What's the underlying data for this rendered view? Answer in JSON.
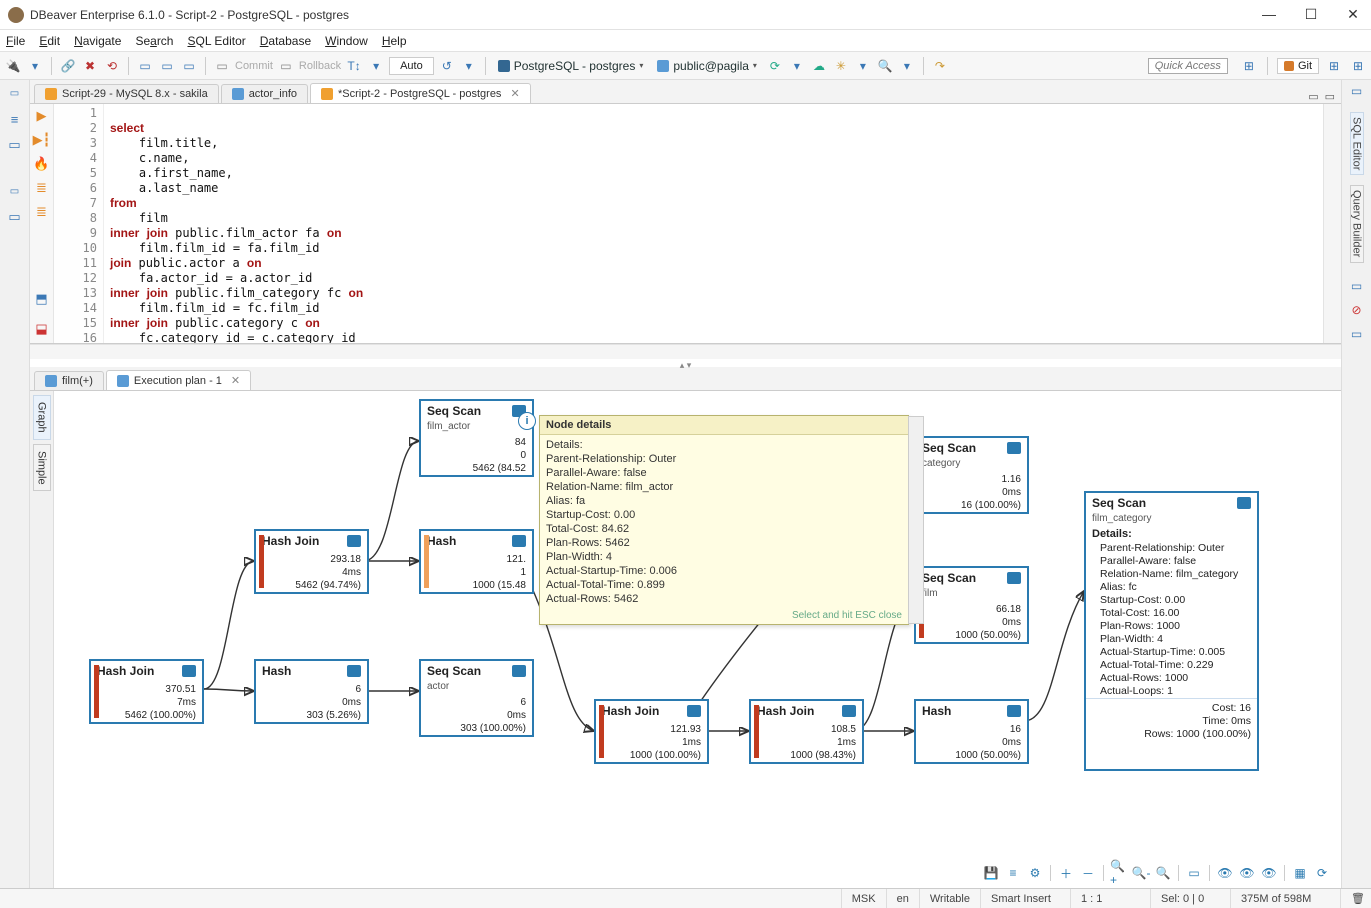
{
  "window": {
    "title": "DBeaver Enterprise 6.1.0 - Script-2 - PostgreSQL - postgres"
  },
  "menu": [
    "File",
    "Edit",
    "Navigate",
    "Search",
    "SQL Editor",
    "Database",
    "Window",
    "Help"
  ],
  "toolbar": {
    "commit": "Commit",
    "rollback": "Rollback",
    "auto": "Auto",
    "conn": "PostgreSQL - postgres",
    "schema": "public@pagila",
    "quick_access": "Quick Access",
    "git": "Git"
  },
  "tabs": [
    {
      "label": "Script-29 - MySQL 8.x - sakila",
      "active": false,
      "icon": "sql"
    },
    {
      "label": "actor_info",
      "active": false,
      "icon": "table"
    },
    {
      "label": "*Script-2 - PostgreSQL - postgres",
      "active": true,
      "icon": "sql"
    }
  ],
  "sql_lines": [
    "",
    "select",
    "    film.title,",
    "    c.name,",
    "    a.first_name,",
    "    a.last_name",
    "from",
    "    film",
    "inner join public.film_actor fa on",
    "    film.film_id = fa.film_id",
    "join public.actor a on",
    "    fa.actor_id = a.actor_id",
    "inner join public.film_category fc on",
    "    film.film_id = fc.film_id",
    "inner join public.category c on",
    "    fc.category_id = c.category_id"
  ],
  "result_tabs": [
    {
      "label": "film(+)",
      "active": false,
      "icon": "table"
    },
    {
      "label": "Execution plan - 1",
      "active": true,
      "icon": "plan"
    }
  ],
  "side_tabs": {
    "left": [
      "Graph",
      "Simple"
    ],
    "right": [
      "SQL Editor",
      "Query Builder"
    ]
  },
  "nodes": {
    "hashjoin_root": {
      "title": "Hash Join",
      "c": "370.51",
      "t": "7ms",
      "r": "5462 (100.00%)"
    },
    "hashjoin2": {
      "title": "Hash Join",
      "c": "293.18",
      "t": "4ms",
      "r": "5462 (94.74%)"
    },
    "hash_actor": {
      "title": "Hash",
      "c": "6",
      "t": "0ms",
      "r": "303 (5.26%)"
    },
    "seq_filmactor": {
      "title": "Seq Scan",
      "sub": "film_actor",
      "c": "84",
      "t": "0",
      "r": "5462 (84.52"
    },
    "hash_mid": {
      "title": "Hash",
      "c": "121.",
      "t": "1",
      "r": "1000 (15.48"
    },
    "seq_actor": {
      "title": "Seq Scan",
      "sub": "actor",
      "c": "6",
      "t": "0ms",
      "r": "303 (100.00%)"
    },
    "hashjoin3": {
      "title": "Hash Join",
      "c": "121.93",
      "t": "1ms",
      "r": "1000 (100.00%)"
    },
    "hashjoin4": {
      "title": "Hash Join",
      "c": "108.5",
      "t": "1ms",
      "r": "1000 (98.43%)"
    },
    "hash_cat": {
      "title": "Hash",
      "c": "16",
      "t": "0ms",
      "r": "1000 (50.00%)"
    },
    "seq_cat": {
      "title": "Seq Scan",
      "sub": "category",
      "c": "1.16",
      "t": "0ms",
      "r": "16 (100.00%)"
    },
    "seq_film": {
      "title": "Seq Scan",
      "sub": "film",
      "c": "66.18",
      "t": "0ms",
      "r": "1000 (50.00%)"
    }
  },
  "tooltip": {
    "head": "Node details",
    "lines": [
      "Details:",
      "    Parent-Relationship: Outer",
      "    Parallel-Aware: false",
      "    Relation-Name: film_actor",
      "    Alias: fa",
      "    Startup-Cost: 0.00",
      "    Total-Cost: 84.62",
      "    Plan-Rows: 5462",
      "    Plan-Width: 4",
      "    Actual-Startup-Time: 0.006",
      "    Actual-Total-Time: 0.899",
      "    Actual-Rows: 5462"
    ],
    "foot": "Select and hit ESC close"
  },
  "bignode": {
    "title": "Seq Scan",
    "sub": "film_category",
    "dh": "Details:",
    "lines": [
      "Parent-Relationship: Outer",
      "Parallel-Aware: false",
      "Relation-Name: film_category",
      "Alias: fc",
      "Startup-Cost: 0.00",
      "Total-Cost: 16.00",
      "Plan-Rows: 1000",
      "Plan-Width: 4",
      "Actual-Startup-Time: 0.005",
      "Actual-Total-Time: 0.229",
      "Actual-Rows: 1000",
      "Actual-Loops: 1"
    ],
    "foot": [
      "Cost: 16",
      "Time: 0ms",
      "Rows: 1000 (100.00%)"
    ]
  },
  "status": {
    "msk": "MSK",
    "en": "en",
    "write": "Writable",
    "insert": "Smart Insert",
    "pos": "1 : 1",
    "sel": "Sel: 0 | 0",
    "mem": "375M of 598M"
  }
}
